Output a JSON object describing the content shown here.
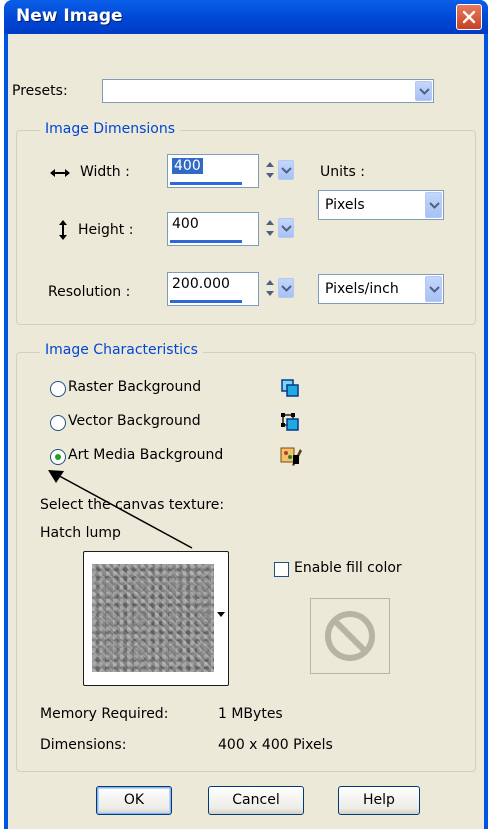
{
  "window": {
    "title": "New Image"
  },
  "presets": {
    "label": "Presets:",
    "value": ""
  },
  "dimensions": {
    "group_title": "Image Dimensions",
    "width_label": "Width :",
    "width_value": "400",
    "height_label": "Height :",
    "height_value": "400",
    "resolution_label": "Resolution :",
    "resolution_value": "200.000",
    "units_label": "Units :",
    "units_value": "Pixels",
    "resolution_units_value": "Pixels/inch"
  },
  "characteristics": {
    "group_title": "Image Characteristics",
    "options": [
      {
        "label": "Raster Background",
        "selected": false,
        "icon": "raster-layer-icon"
      },
      {
        "label": "Vector Background",
        "selected": false,
        "icon": "vector-layer-icon"
      },
      {
        "label": "Art Media Background",
        "selected": true,
        "icon": "art-media-icon"
      }
    ],
    "texture_prompt": "Select the canvas texture:",
    "texture_name": "Hatch lump",
    "enable_fill_label": "Enable fill color",
    "enable_fill_checked": false,
    "memory_label": "Memory Required:",
    "memory_value": "1 MBytes",
    "dimensions_label": "Dimensions:",
    "dimensions_value": "400 x 400 Pixels"
  },
  "buttons": {
    "ok": "OK",
    "cancel": "Cancel",
    "help": "Help"
  },
  "colors": {
    "title_bar": "#0054e3",
    "dialog_bg": "#ece9d8",
    "group_title": "#0046d5",
    "close": "#c64125"
  }
}
